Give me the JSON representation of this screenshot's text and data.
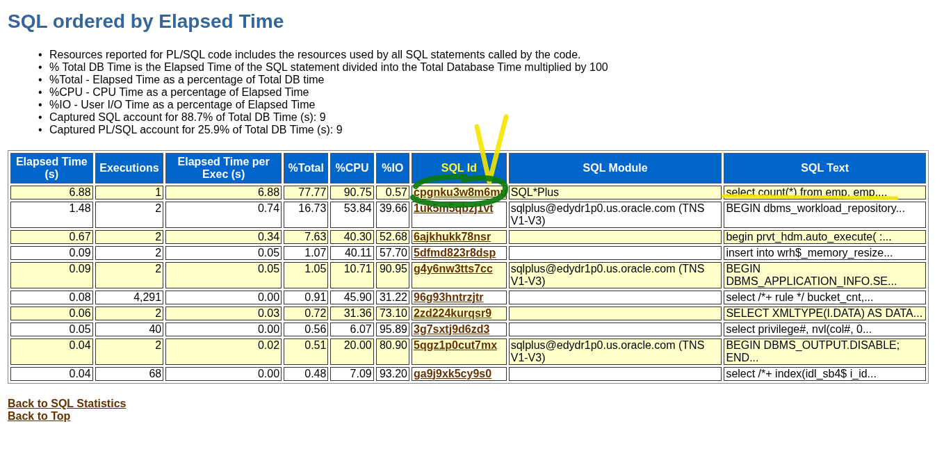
{
  "title": "SQL ordered by Elapsed Time",
  "notes": [
    {
      "marker": "•",
      "text": "Resources reported for PL/SQL code includes the resources used by all SQL statements called by the code."
    },
    {
      "marker": "•",
      "text": "% Total DB Time is the Elapsed Time of the SQL statement divided into the Total Database Time multiplied by 100"
    },
    {
      "marker": "•",
      "text": "%Total - Elapsed Time as a percentage of Total DB time"
    },
    {
      "marker": "•",
      "text": "%CPU - CPU Time as a percentage of Elapsed Time"
    },
    {
      "marker": "•",
      "text": "%IO - User I/O Time as a percentage of Elapsed Time"
    },
    {
      "marker": "•",
      "text": "Captured SQL account for 88.7% of Total DB Time (s): 9"
    },
    {
      "marker": "•",
      "text": "Captured PL/SQL account for 25.9% of Total DB Time (s): 9"
    }
  ],
  "table": {
    "columns": [
      "Elapsed Time (s)",
      "Executions",
      "Elapsed Time per Exec (s)",
      "%Total",
      "%CPU",
      "%IO",
      "SQL Id",
      "SQL Module",
      "SQL Text"
    ],
    "rows": [
      {
        "elapsed": "6.88",
        "executions": "1",
        "per_exec": "6.88",
        "total": "77.77",
        "cpu": "90.75",
        "io": "0.57",
        "sql_id": "cpgnku3w8m6mu",
        "module": "SQL*Plus",
        "text": "select count(*) from emp, emp,..."
      },
      {
        "elapsed": "1.48",
        "executions": "2",
        "per_exec": "0.74",
        "total": "16.73",
        "cpu": "53.84",
        "io": "39.66",
        "sql_id": "1uk5m5qbzj1vt",
        "module": "sqlplus@edydr1p0.us.oracle.com (TNS V1-V3)",
        "text": "BEGIN dbms_workload_repository..."
      },
      {
        "elapsed": "0.67",
        "executions": "2",
        "per_exec": "0.34",
        "total": "7.63",
        "cpu": "40.30",
        "io": "52.68",
        "sql_id": "6ajkhukk78nsr",
        "text": "begin prvt_hdm.auto_execute( :..."
      },
      {
        "elapsed": "0.09",
        "executions": "2",
        "per_exec": "0.05",
        "total": "1.07",
        "cpu": "40.11",
        "io": "57.70",
        "sql_id": "5dfmd823r8dsp",
        "text": "insert into wrh$_memory_resize..."
      },
      {
        "elapsed": "0.09",
        "executions": "2",
        "per_exec": "0.05",
        "total": "1.05",
        "cpu": "10.71",
        "io": "90.95",
        "sql_id": "g4y6nw3tts7cc",
        "module": "sqlplus@edydr1p0.us.oracle.com (TNS V1-V3)",
        "text": "BEGIN DBMS_APPLICATION_INFO.SE..."
      },
      {
        "elapsed": "0.08",
        "executions": "4,291",
        "per_exec": "0.00",
        "total": "0.91",
        "cpu": "45.90",
        "io": "31.22",
        "sql_id": "96g93hntrzjtr",
        "text": "select /*+ rule */ bucket_cnt,..."
      },
      {
        "elapsed": "0.06",
        "executions": "2",
        "per_exec": "0.03",
        "total": "0.72",
        "cpu": "31.36",
        "io": "73.10",
        "sql_id": "2zd224kurqsr9",
        "text": "SELECT XMLTYPE(I.DATA) AS DATA..."
      },
      {
        "elapsed": "0.05",
        "executions": "40",
        "per_exec": "0.00",
        "total": "0.56",
        "cpu": "6.07",
        "io": "95.89",
        "sql_id": "3g7sxtj9d6zd3",
        "text": "select privilege#, nvl(col#, 0..."
      },
      {
        "elapsed": "0.04",
        "executions": "2",
        "per_exec": "0.02",
        "total": "0.51",
        "cpu": "20.00",
        "io": "80.90",
        "sql_id": "5qgz1p0cut7mx",
        "module": "sqlplus@edydr1p0.us.oracle.com (TNS V1-V3)",
        "text": "BEGIN DBMS_OUTPUT.DISABLE; END..."
      },
      {
        "elapsed": "0.04",
        "executions": "68",
        "per_exec": "0.00",
        "total": "0.48",
        "cpu": "7.09",
        "io": "93.20",
        "sql_id": "ga9j9xk5cy9s0",
        "text": "select /*+ index(idl_sb4$ i_id..."
      }
    ]
  },
  "links": [
    "Back to SQL Statistics",
    "Back to Top"
  ]
}
